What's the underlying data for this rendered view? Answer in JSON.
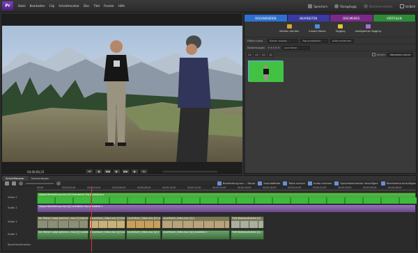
{
  "menubar": {
    "items": [
      "Datei",
      "Bearbeiten",
      "Clip",
      "Schnittmonitor",
      "Disc",
      "Titel",
      "Fenster",
      "Hilfe"
    ],
    "actions": [
      {
        "label": "Speichern",
        "icon": "save-icon",
        "enabled": true
      },
      {
        "label": "Rückgängig",
        "icon": "undo-icon",
        "enabled": true
      },
      {
        "label": "Wiederherstellen",
        "icon": "redo-icon",
        "enabled": false
      },
      {
        "label": "Vollbild",
        "icon": "fullscreen-icon",
        "enabled": true
      }
    ]
  },
  "monitor": {
    "timecode": "00;00;06;25"
  },
  "panel": {
    "tabs": [
      {
        "label": "ORGANISIEREN",
        "color": "#2f6fd0"
      },
      {
        "label": "BEARBEITEN",
        "color": "#3a3aa0"
      },
      {
        "label": "DISCMENÜS",
        "color": "#7a2a86"
      },
      {
        "label": "VERTEILEN",
        "color": "#2f8a3a"
      }
    ],
    "tools": [
      {
        "label": "Medien abrufen",
        "icon": "get-media-icon",
        "color": "#d9a530"
      },
      {
        "label": "Instant Movie",
        "icon": "instant-movie-icon",
        "color": "#4a8fd8"
      },
      {
        "label": "Tagging",
        "icon": "tagging-icon",
        "color": "#e3c43a"
      },
      {
        "label": "Intelligentes Tagging",
        "icon": "smart-tagging-icon",
        "color": "#b06ad8"
      }
    ],
    "filter": {
      "label": "Filtern nach",
      "album": "Album auswä...",
      "tag": "Tag auswählen",
      "clear": "Alles entfernen"
    },
    "rating": {
      "label": "Bewertungen",
      "value": "und höher"
    },
    "details_label": "Details",
    "sort_label": "Neuestes zuerst"
  },
  "timeline": {
    "tabs": [
      "Schnittfenster",
      "Szenenfolgen"
    ],
    "actions": [
      {
        "label": "Bearbeitung von ... Dauer",
        "icon": "edit-icon"
      },
      {
        "label": "Soundeffekte",
        "icon": "speaker-icon"
      },
      {
        "label": "Takte suchen",
        "icon": "beat-icon"
      },
      {
        "label": "Audio mischen",
        "icon": "audio-mix-icon"
      },
      {
        "label": "Sprachkommentar hinzufügen",
        "icon": "voiceover-icon"
      },
      {
        "label": "Nennthema hinzufügen",
        "icon": "theme-icon"
      }
    ],
    "ruler": [
      "00;00",
      "00;00;02;00",
      "00;00;04;00",
      "00;00;06;00",
      "00;00;08;00",
      "00;00;10;00",
      "00;00;12;00",
      "00;00;14;00",
      "00;00;16;00",
      "00;00;18;00",
      "00;00;20;00",
      "00;00;22;00",
      "00;00;24;00",
      "00;00;26;00",
      "00;00;28;00"
    ],
    "tracks": [
      {
        "label": "Video 2",
        "clip": "Zipped Bearbeitung.mov [V] Grenzwerte Clip-Einstellung ▾"
      },
      {
        "label": "Audio 2",
        "clip": "Zipped Bearbeitung.mov [A] Lautstärke Clip-Lautstärke ▾"
      },
      {
        "label": "Video 1",
        "clips": [
          "Der Wiener Lodge getrennt...mov [V] Intensität ▾",
          "Leuchtturm_Video.mov [V] Intensität ▾",
          "Leuchtturm_Video.mov [V] Lautstärke ▾",
          "Leuchtturm_Video.mov [V] ▾",
          "Tiefe Bodenaufnahme [V]"
        ]
      },
      {
        "label": "Audio 1",
        "clips": [
          "Der Wiener Lodge getrennt...mov [A] Lautstärke ▾",
          "Leuchtturm_Video.mov [A] Lautstärke ▾",
          "Leuchtturm_Video.mov [A] ▾",
          "Leuchtturm_Video.mov [A] Lautstärke ▾",
          "Tiefe Bodenaufnahme [A]"
        ]
      },
      {
        "label": "Sprachkommentar"
      }
    ]
  }
}
